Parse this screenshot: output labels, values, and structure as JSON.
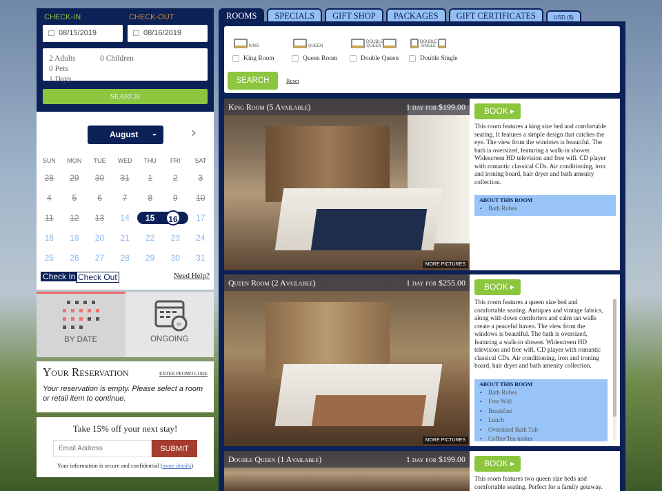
{
  "booking": {
    "checkin_label": "CHECK-IN",
    "checkout_label": "CHECK-OUT",
    "checkin": "08/15/2019",
    "checkout": "08/16/2019",
    "adults": "2 Adults",
    "children": "0 Children",
    "pets": "0 Pets",
    "days": "1 Days",
    "search": "SEARCH",
    "checkin_color": "#8cc63f",
    "checkout_color": "#e08a2a"
  },
  "calendar": {
    "month": "August",
    "weekdays": [
      "SUN",
      "MON",
      "TUE",
      "WED",
      "THU",
      "FRI",
      "SAT"
    ],
    "days": [
      [
        "28",
        "past"
      ],
      [
        "29",
        "past"
      ],
      [
        "30",
        "past"
      ],
      [
        "31",
        "past"
      ],
      [
        "1",
        "past"
      ],
      [
        "2",
        "past"
      ],
      [
        "3",
        "past"
      ],
      [
        "4",
        "past"
      ],
      [
        "5",
        "past"
      ],
      [
        "6",
        "past"
      ],
      [
        "7",
        "past"
      ],
      [
        "8",
        "past"
      ],
      [
        "9",
        "past"
      ],
      [
        "10",
        "past"
      ],
      [
        "11",
        "past"
      ],
      [
        "12",
        "past"
      ],
      [
        "13",
        "past"
      ],
      [
        "14",
        "av"
      ],
      [
        "15",
        "checkin"
      ],
      [
        "16",
        "checkout"
      ],
      [
        "17",
        "av"
      ],
      [
        "18",
        "av"
      ],
      [
        "19",
        "av"
      ],
      [
        "20",
        "av"
      ],
      [
        "21",
        "av"
      ],
      [
        "22",
        "av"
      ],
      [
        "23",
        "av"
      ],
      [
        "24",
        "av"
      ],
      [
        "25",
        "av"
      ],
      [
        "26",
        "av"
      ],
      [
        "27",
        "av"
      ],
      [
        "28",
        "av"
      ],
      [
        "29",
        "av"
      ],
      [
        "30",
        "av"
      ],
      [
        "31",
        "av"
      ]
    ],
    "check_in": "Check In",
    "check_out": "Check Out",
    "help": "Need Help?"
  },
  "mode": {
    "by_date": "BY DATE",
    "ongoing": "ONGOING",
    "active": "by_date"
  },
  "reservation": {
    "title": "Your Reservation",
    "promo": "ENTER PROMO CODE",
    "empty": "Your reservation is empty. Please select a room or retail item to continue."
  },
  "promo": {
    "title": "Take 15% off your next stay!",
    "placeholder": "Email Address",
    "submit": "SUBMIT",
    "note": "Your information is secure and confidential (",
    "link": "more details",
    ",close": ")"
  },
  "tabs": [
    "ROOMS",
    "SPECIALS",
    "GIFT SHOP",
    "PACKAGES",
    "GIFT CERTIFICATES",
    "USD ($)"
  ],
  "filters": {
    "types": [
      {
        "icon": "KING",
        "label": "King Room"
      },
      {
        "icon": "QUEEN",
        "label": "Queen Room"
      },
      {
        "icon": "DOUBLE QUEEN",
        "label": "Double Queen"
      },
      {
        "icon": "DOUBLE SINGLE",
        "label": "Double Single"
      }
    ],
    "search": "SEARCH",
    "reset": "Reset"
  },
  "rooms": [
    {
      "title": "King Room (5 Available)",
      "price": "1 day for $199.00",
      "book": "BOOK",
      "more": "MORE PICTURES",
      "desc": "This room features a king size bed and comfortable seating. It features a simple design that catches the eye. The view from the windows is beautiful. The bath is oversized, featuring a walk-in shower. Widescreen HD television and free wifi. CD player with romantic classical CDs. Air conditioning, iron and ironing board, hair dryer and bath amenity collection.",
      "about": "ABOUT THIS ROOM",
      "amenities": [
        "Bath Robes"
      ]
    },
    {
      "title": "Queen Room (2 Available)",
      "price": "1 day for $255.00",
      "book": "BOOK",
      "more": "MORE PICTURES",
      "desc": "This room features a queen size bed and comfortable seating. Antiques and vintage fabrics, along with down comforters and calm tan walls create a peaceful haven. The view from the windows is beautiful. The bath is oversized, featuring a walk-in shower. Widescreen HD television and free wifi. CD player with romantic classical CDs. Air conditioning, iron and ironing board, hair dryer and bath amenity collection.",
      "about": "ABOUT THIS ROOM",
      "amenities": [
        "Bath Robes",
        "Free Wifi",
        "Breakfast",
        "Lunch",
        "Oversized Bath Tub",
        "Coffee/Tea maker"
      ]
    },
    {
      "title": "Double Queen (1 Available)",
      "price": "1 day for $199.00",
      "book": "BOOK",
      "desc": "This room features two queen size beds and comfortable seating. Perfect for a family getaway."
    }
  ]
}
